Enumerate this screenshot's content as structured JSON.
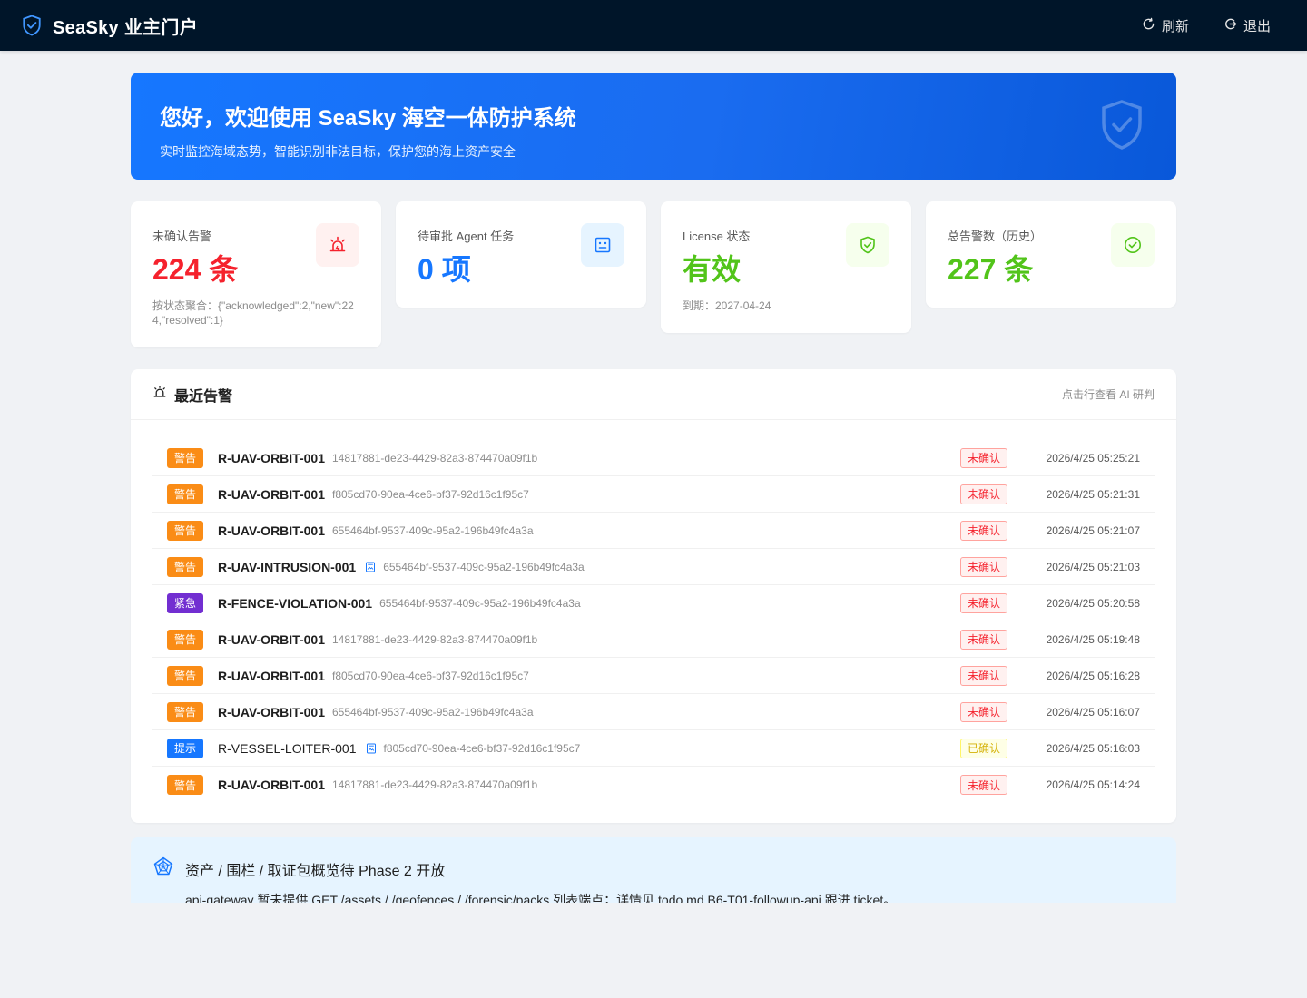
{
  "app": {
    "title": "SeaSky 业主门户",
    "refresh_label": "刷新",
    "logout_label": "退出"
  },
  "banner": {
    "title": "您好，欢迎使用 SeaSky 海空一体防护系统",
    "subtitle": "实时监控海域态势，智能识别非法目标，保护您的海上资产安全"
  },
  "stats": [
    {
      "label": "未确认告警",
      "value": "224 条",
      "note": "按状态聚合：{\"acknowledged\":2,\"new\":224,\"resolved\":1}",
      "color": "#f5222d",
      "icon_bg": "#fff1f0",
      "icon": "alarm-icon"
    },
    {
      "label": "待审批 Agent 任务",
      "value": "0 项",
      "note": "",
      "color": "#1677ff",
      "icon_bg": "#e6f4ff",
      "icon": "robot-icon"
    },
    {
      "label": "License 状态",
      "value": "有效",
      "note": "到期：2027-04-24",
      "color": "#52c41a",
      "icon_bg": "#f6ffed",
      "icon": "safety-icon"
    },
    {
      "label": "总告警数（历史）",
      "value": "227 条",
      "note": "",
      "color": "#52c41a",
      "icon_bg": "#f6ffed",
      "icon": "check-circle-icon"
    }
  ],
  "alerts": {
    "title": "最近告警",
    "hint": "点击行查看 AI 研判",
    "rows": [
      {
        "severity": "警告",
        "severity_color": "#fa8c16",
        "rule": "R-UAV-ORBIT-001",
        "has_image": false,
        "uuid": "14817881-de23-4429-82a3-874470a09f1b",
        "status": "未确认",
        "status_type": "unack",
        "time": "2026/4/25 05:25:21"
      },
      {
        "severity": "警告",
        "severity_color": "#fa8c16",
        "rule": "R-UAV-ORBIT-001",
        "has_image": false,
        "uuid": "f805cd70-90ea-4ce6-bf37-92d16c1f95c7",
        "status": "未确认",
        "status_type": "unack",
        "time": "2026/4/25 05:21:31"
      },
      {
        "severity": "警告",
        "severity_color": "#fa8c16",
        "rule": "R-UAV-ORBIT-001",
        "has_image": false,
        "uuid": "655464bf-9537-409c-95a2-196b49fc4a3a",
        "status": "未确认",
        "status_type": "unack",
        "time": "2026/4/25 05:21:07"
      },
      {
        "severity": "警告",
        "severity_color": "#fa8c16",
        "rule": "R-UAV-INTRUSION-001",
        "has_image": true,
        "uuid": "655464bf-9537-409c-95a2-196b49fc4a3a",
        "status": "未确认",
        "status_type": "unack",
        "time": "2026/4/25 05:21:03"
      },
      {
        "severity": "紧急",
        "severity_color": "#722ed1",
        "rule": "R-FENCE-VIOLATION-001",
        "has_image": false,
        "uuid": "655464bf-9537-409c-95a2-196b49fc4a3a",
        "status": "未确认",
        "status_type": "unack",
        "time": "2026/4/25 05:20:58"
      },
      {
        "severity": "警告",
        "severity_color": "#fa8c16",
        "rule": "R-UAV-ORBIT-001",
        "has_image": false,
        "uuid": "14817881-de23-4429-82a3-874470a09f1b",
        "status": "未确认",
        "status_type": "unack",
        "time": "2026/4/25 05:19:48"
      },
      {
        "severity": "警告",
        "severity_color": "#fa8c16",
        "rule": "R-UAV-ORBIT-001",
        "has_image": false,
        "uuid": "f805cd70-90ea-4ce6-bf37-92d16c1f95c7",
        "status": "未确认",
        "status_type": "unack",
        "time": "2026/4/25 05:16:28"
      },
      {
        "severity": "警告",
        "severity_color": "#fa8c16",
        "rule": "R-UAV-ORBIT-001",
        "has_image": false,
        "uuid": "655464bf-9537-409c-95a2-196b49fc4a3a",
        "status": "未确认",
        "status_type": "unack",
        "time": "2026/4/25 05:16:07"
      },
      {
        "severity": "提示",
        "severity_color": "#1677ff",
        "rule": "R-VESSEL-LOITER-001",
        "rule_weight": "normal",
        "has_image": true,
        "uuid": "f805cd70-90ea-4ce6-bf37-92d16c1f95c7",
        "status": "已确认",
        "status_type": "ack",
        "time": "2026/4/25 05:16:03"
      },
      {
        "severity": "警告",
        "severity_color": "#fa8c16",
        "rule": "R-UAV-ORBIT-001",
        "has_image": false,
        "uuid": "14817881-de23-4429-82a3-874470a09f1b",
        "status": "未确认",
        "status_type": "unack",
        "time": "2026/4/25 05:14:24"
      }
    ]
  },
  "phase": {
    "title": "资产 / 围栏 / 取证包概览待 Phase 2 开放",
    "description": "api-gateway 暂未提供 GET /assets / /geofences / /forensic/packs 列表端点；详情见 todo.md B6-T01-followup-api 跟进 ticket。"
  }
}
